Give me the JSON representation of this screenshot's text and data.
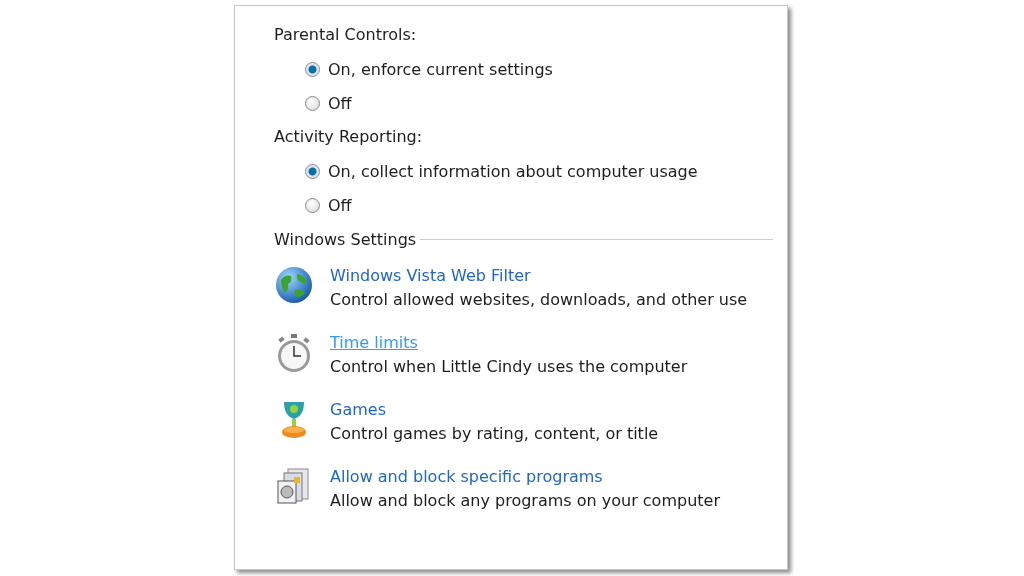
{
  "groups": [
    {
      "label": "Parental Controls:",
      "options": [
        {
          "label": "On, enforce current settings",
          "selected": true
        },
        {
          "label": "Off",
          "selected": false
        }
      ]
    },
    {
      "label": "Activity Reporting:",
      "options": [
        {
          "label": "On, collect information about computer usage",
          "selected": true
        },
        {
          "label": "Off",
          "selected": false
        }
      ]
    }
  ],
  "windows_settings": {
    "title": "Windows Settings",
    "items": [
      {
        "kind": "globe",
        "link": "Windows Vista Web Filter",
        "description": "Control allowed websites, downloads, and other use",
        "hovered": false
      },
      {
        "kind": "stopwatch",
        "link": "Time limits",
        "description": "Control when Little Cindy uses the computer",
        "hovered": true
      },
      {
        "kind": "trophy",
        "link": "Games",
        "description": "Control games by rating, content, or title",
        "hovered": false
      },
      {
        "kind": "programs",
        "link": "Allow and block specific programs",
        "description": "Allow and block any programs on your computer",
        "hovered": false
      }
    ]
  }
}
